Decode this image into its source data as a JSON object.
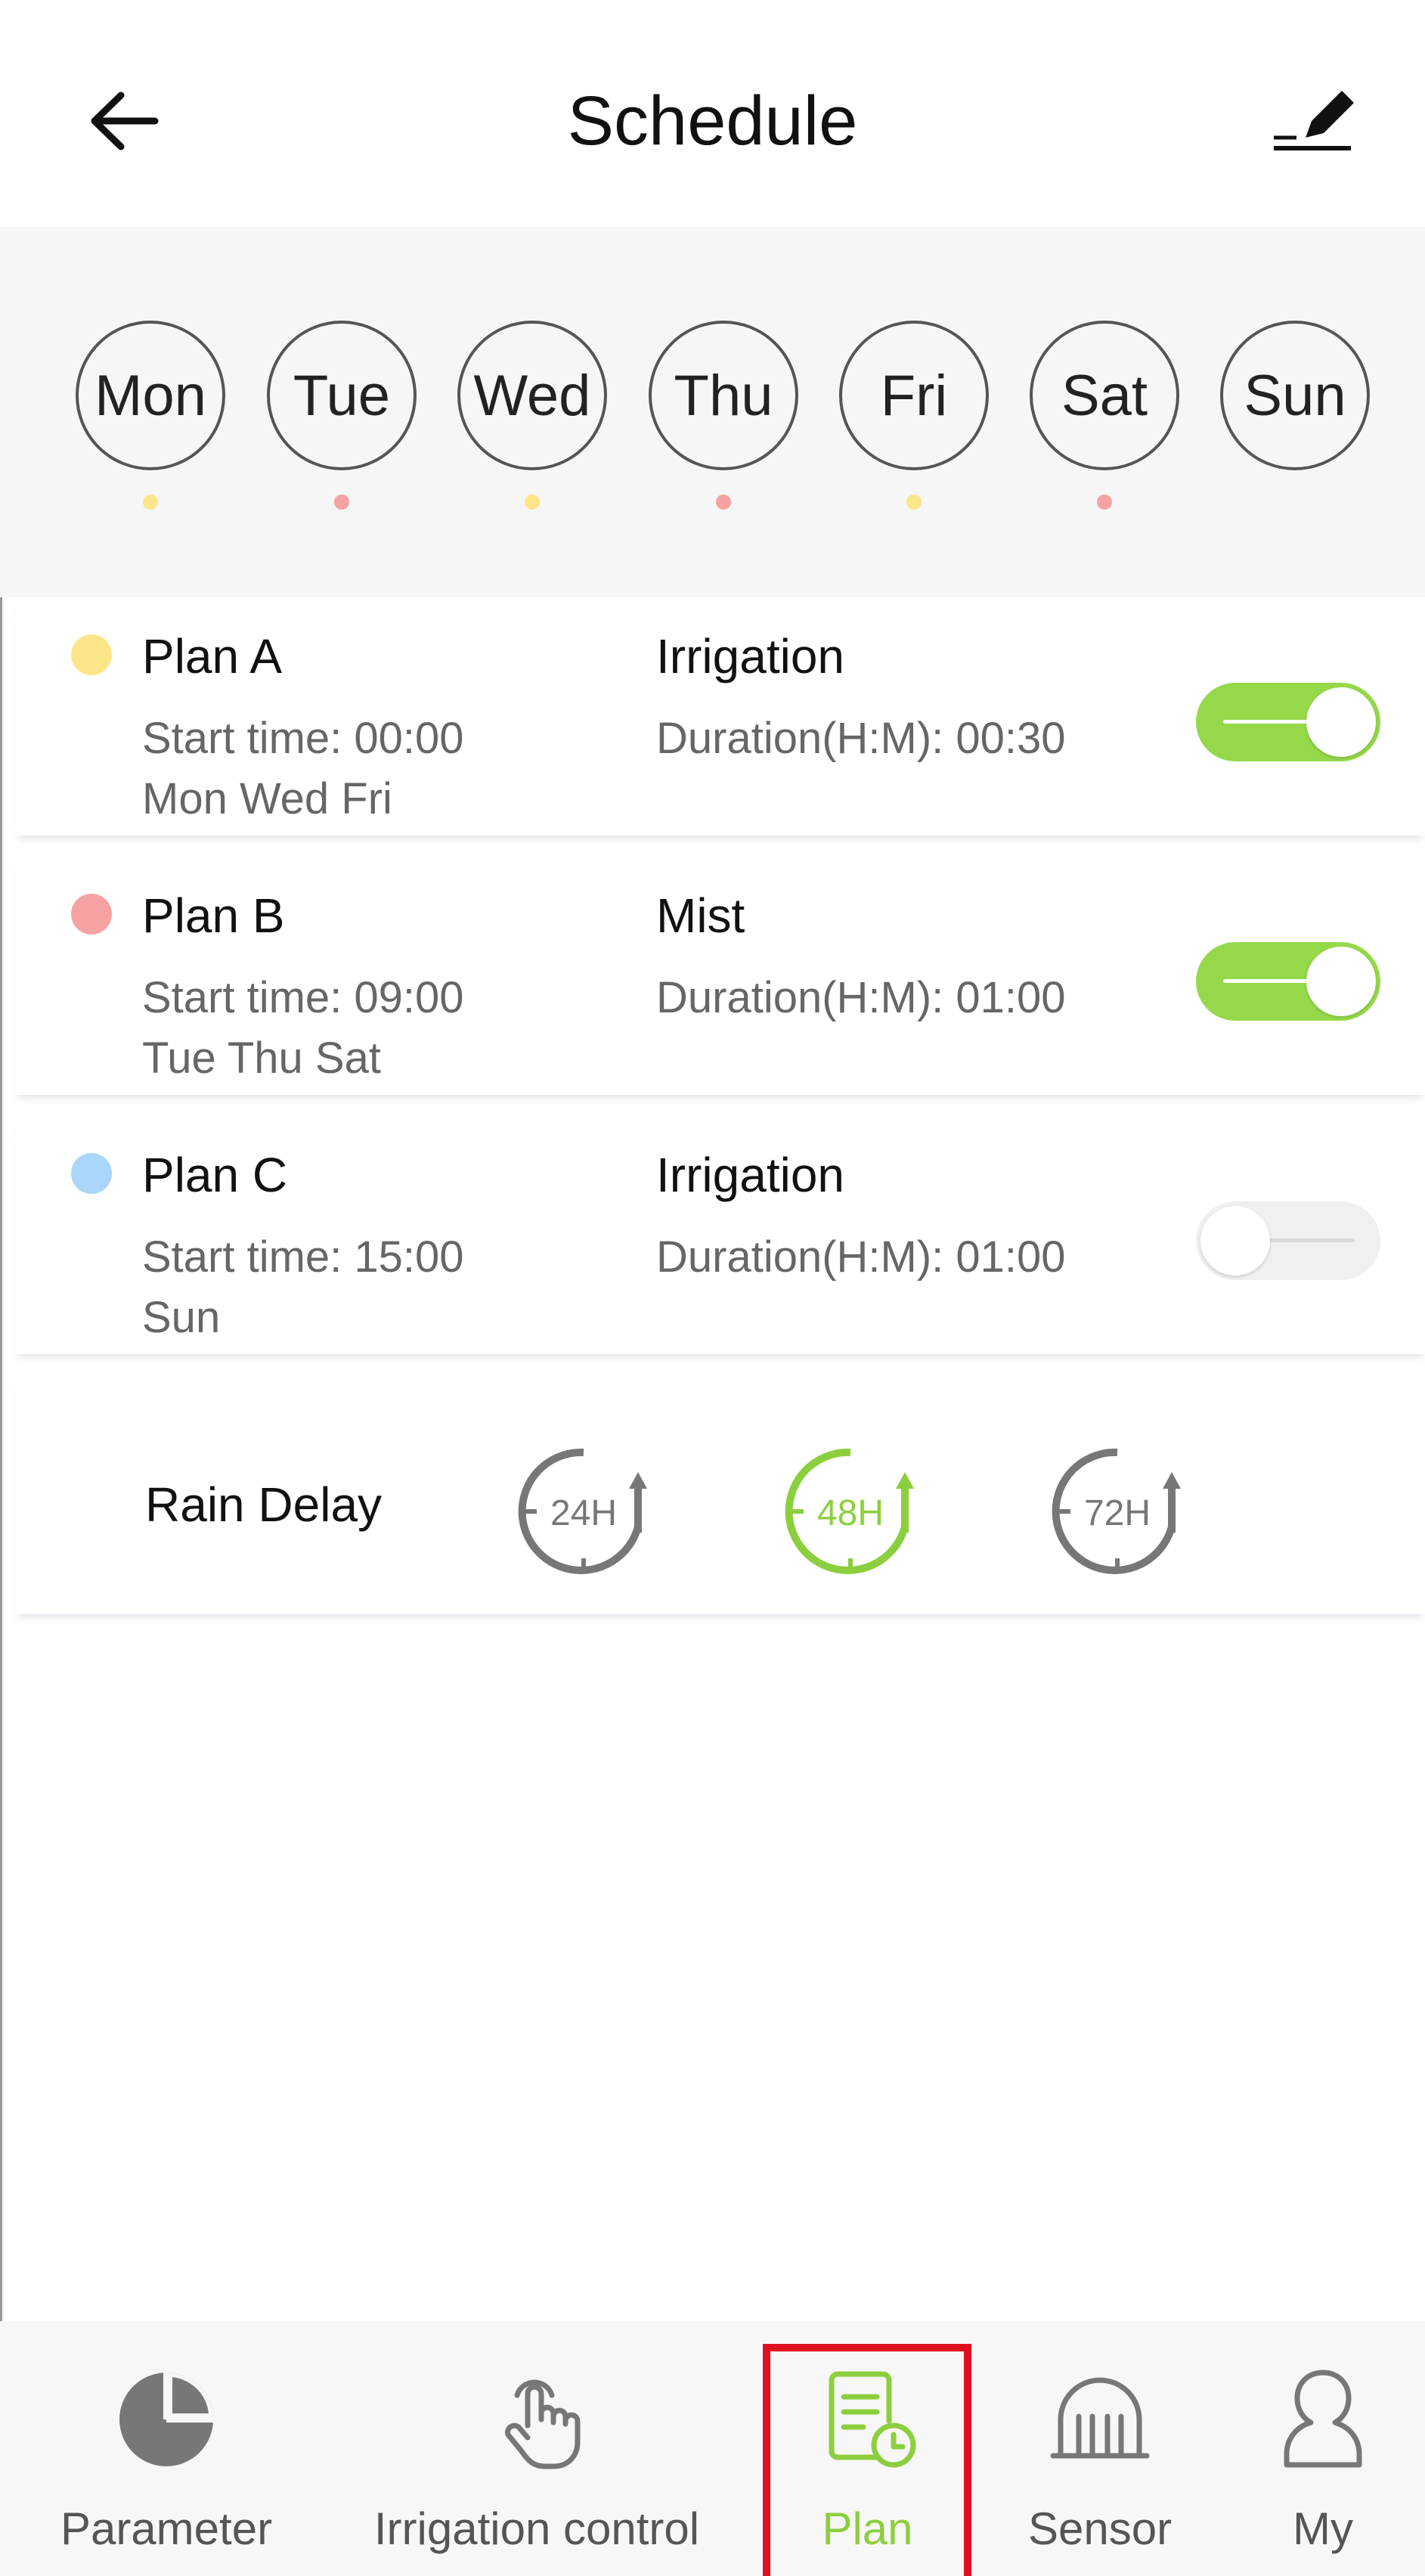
{
  "header": {
    "title": "Schedule",
    "back_icon": "arrow-left-icon",
    "edit_icon": "edit-pencil-icon"
  },
  "days": [
    {
      "label": "Mon",
      "dot_color": "#fde58a"
    },
    {
      "label": "Tue",
      "dot_color": "#f6a2a2"
    },
    {
      "label": "Wed",
      "dot_color": "#fde58a"
    },
    {
      "label": "Thu",
      "dot_color": "#f6a2a2"
    },
    {
      "label": "Fri",
      "dot_color": "#fde58a"
    },
    {
      "label": "Sat",
      "dot_color": "#f6a2a2"
    },
    {
      "label": "Sun",
      "dot_color": ""
    }
  ],
  "plans": [
    {
      "name": "Plan A",
      "color": "#fde58a",
      "mode": "Irrigation",
      "start": "Start time: 00:00",
      "duration": "Duration(H:M): 00:30",
      "days": "Mon Wed Fri",
      "enabled": true
    },
    {
      "name": "Plan B",
      "color": "#f6a2a2",
      "mode": "Mist",
      "start": "Start time: 09:00",
      "duration": "Duration(H:M): 01:00",
      "days": "Tue Thu Sat",
      "enabled": true
    },
    {
      "name": "Plan C",
      "color": "#a9d6fa",
      "mode": "Irrigation",
      "start": "Start time: 15:00",
      "duration": "Duration(H:M): 01:00",
      "days": "Sun",
      "enabled": false
    }
  ],
  "rain_delay": {
    "label": "Rain Delay",
    "options": [
      {
        "label": "24H",
        "selected": false
      },
      {
        "label": "48H",
        "selected": true
      },
      {
        "label": "72H",
        "selected": false
      }
    ]
  },
  "nav": {
    "items": [
      {
        "label": "Parameter",
        "icon": "pie-chart-icon"
      },
      {
        "label": "Irrigation control",
        "icon": "hand-pointer-icon"
      },
      {
        "label": "Plan",
        "icon": "plan-schedule-icon",
        "active": true
      },
      {
        "label": "Sensor",
        "icon": "sensor-icon"
      },
      {
        "label": "My",
        "icon": "user-icon"
      }
    ]
  },
  "colors": {
    "accent": "#8ccf3e",
    "toggle_on": "#95d94a",
    "highlight": "#e0101e",
    "inactive_icon": "#777777"
  }
}
